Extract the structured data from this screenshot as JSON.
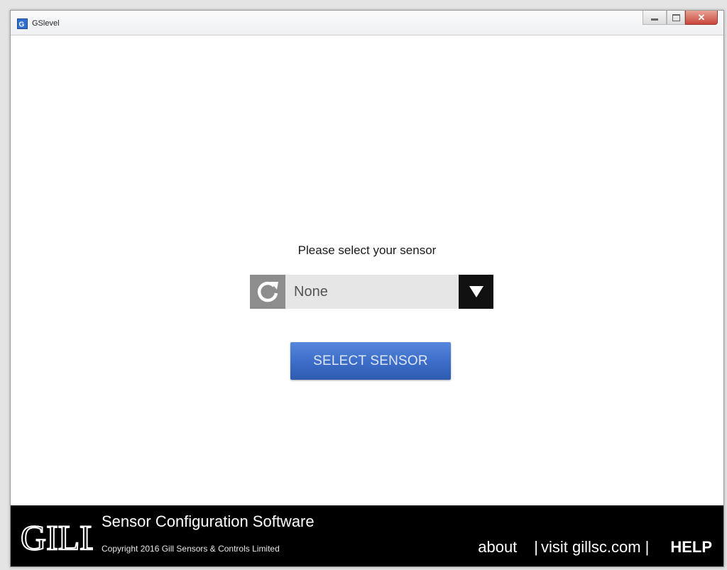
{
  "window": {
    "title": "GSlevel"
  },
  "main": {
    "prompt": "Please select your sensor",
    "dropdown": {
      "selected": "None"
    },
    "select_button_label": "SELECT SENSOR"
  },
  "footer": {
    "logo_text": "GILL",
    "app_name": "Sensor Configuration Software",
    "copyright": "Copyright 2016 Gill Sensors & Controls Limited",
    "links": {
      "about": "about",
      "visit": "visit gillsc.com",
      "help": "HELP"
    },
    "separator": "|"
  },
  "icons": {
    "refresh": "refresh-icon",
    "dropdown_arrow": "triangle-down-icon"
  },
  "colors": {
    "button": "#3d6ec9",
    "footer": "#000000"
  }
}
